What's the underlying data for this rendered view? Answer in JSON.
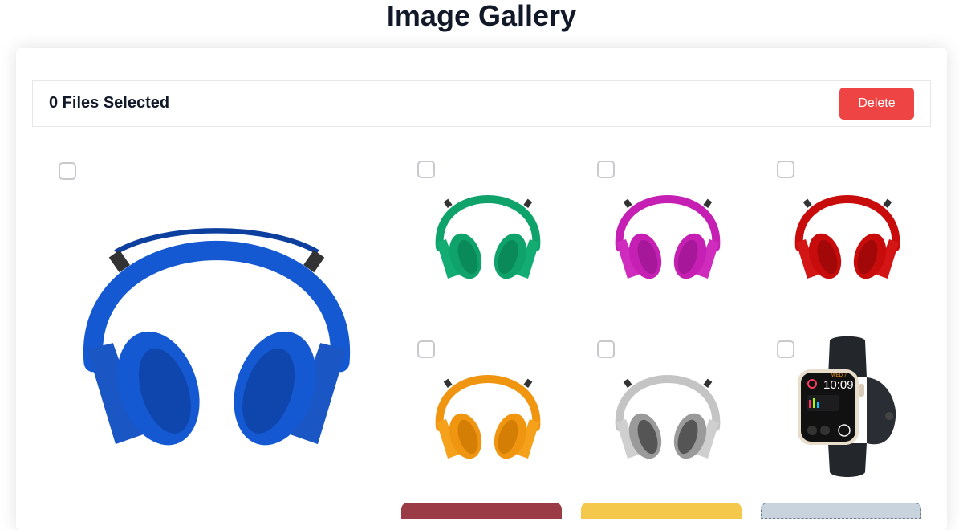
{
  "page": {
    "title": "Image Gallery"
  },
  "toolbar": {
    "selected_label": "0 Files Selected",
    "delete_label": "Delete"
  },
  "colors": {
    "delete_button": "#ef4444",
    "headphone_blue": "#1459d1",
    "headphone_green": "#0fa36b",
    "headphone_magenta": "#c520b3",
    "headphone_red": "#c80c0c",
    "headphone_orange": "#f0950f",
    "headphone_silver": "#bdbdbd",
    "watch_band": "#23272c",
    "watch_case": "#e8dccb"
  },
  "gallery": {
    "items": [
      {
        "icon": "headphones-blue-image",
        "color": "blue",
        "checked": false
      },
      {
        "icon": "headphones-green-image",
        "color": "green",
        "checked": false
      },
      {
        "icon": "headphones-magenta-image",
        "color": "magenta",
        "checked": false
      },
      {
        "icon": "headphones-red-image",
        "color": "red",
        "checked": false
      },
      {
        "icon": "headphones-orange-image",
        "color": "orange",
        "checked": false
      },
      {
        "icon": "headphones-silver-image",
        "color": "silver",
        "checked": false
      },
      {
        "icon": "smartwatch-image",
        "checked": false,
        "watch": {
          "day": "WED 7",
          "time": "10:09"
        }
      }
    ]
  }
}
